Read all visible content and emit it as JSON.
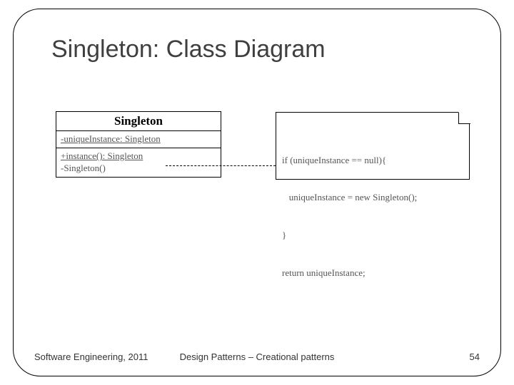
{
  "title": "Singleton: Class Diagram",
  "uml": {
    "className": "Singleton",
    "attributes": [
      "-uniqueInstance: Singleton"
    ],
    "operations": [
      "+instance(): Singleton",
      "-Singleton()"
    ]
  },
  "note": {
    "line1": "if (uniqueInstance == null){",
    "line2": "   uniqueInstance = new Singleton();",
    "line3": "}",
    "line4": "return uniqueInstance;"
  },
  "footer": {
    "left": "Software Engineering, 2011",
    "center": "Design Patterns – Creational patterns",
    "page": "54"
  }
}
